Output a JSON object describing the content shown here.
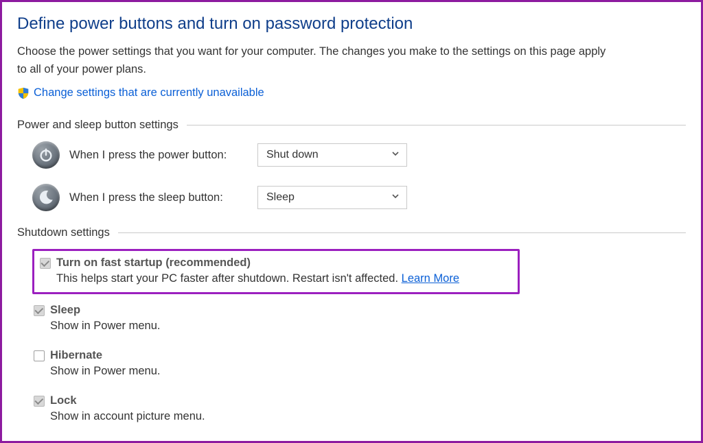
{
  "title": "Define power buttons and turn on password protection",
  "description": "Choose the power settings that you want for your computer. The changes you make to the settings on this page apply to all of your power plans.",
  "change_link": "Change settings that are currently unavailable",
  "groups": {
    "power_sleep": {
      "header": "Power and sleep button settings",
      "power_row": {
        "label": "When I press the power button:",
        "value": "Shut down"
      },
      "sleep_row": {
        "label": "When I press the sleep button:",
        "value": "Sleep"
      }
    },
    "shutdown": {
      "header": "Shutdown settings",
      "fast_startup": {
        "label": "Turn on fast startup (recommended)",
        "desc": "This helps start your PC faster after shutdown. Restart isn't affected. ",
        "learn_more": "Learn More"
      },
      "sleep_opt": {
        "label": "Sleep",
        "desc": "Show in Power menu."
      },
      "hibernate_opt": {
        "label": "Hibernate",
        "desc": "Show in Power menu."
      },
      "lock_opt": {
        "label": "Lock",
        "desc": "Show in account picture menu."
      }
    }
  }
}
